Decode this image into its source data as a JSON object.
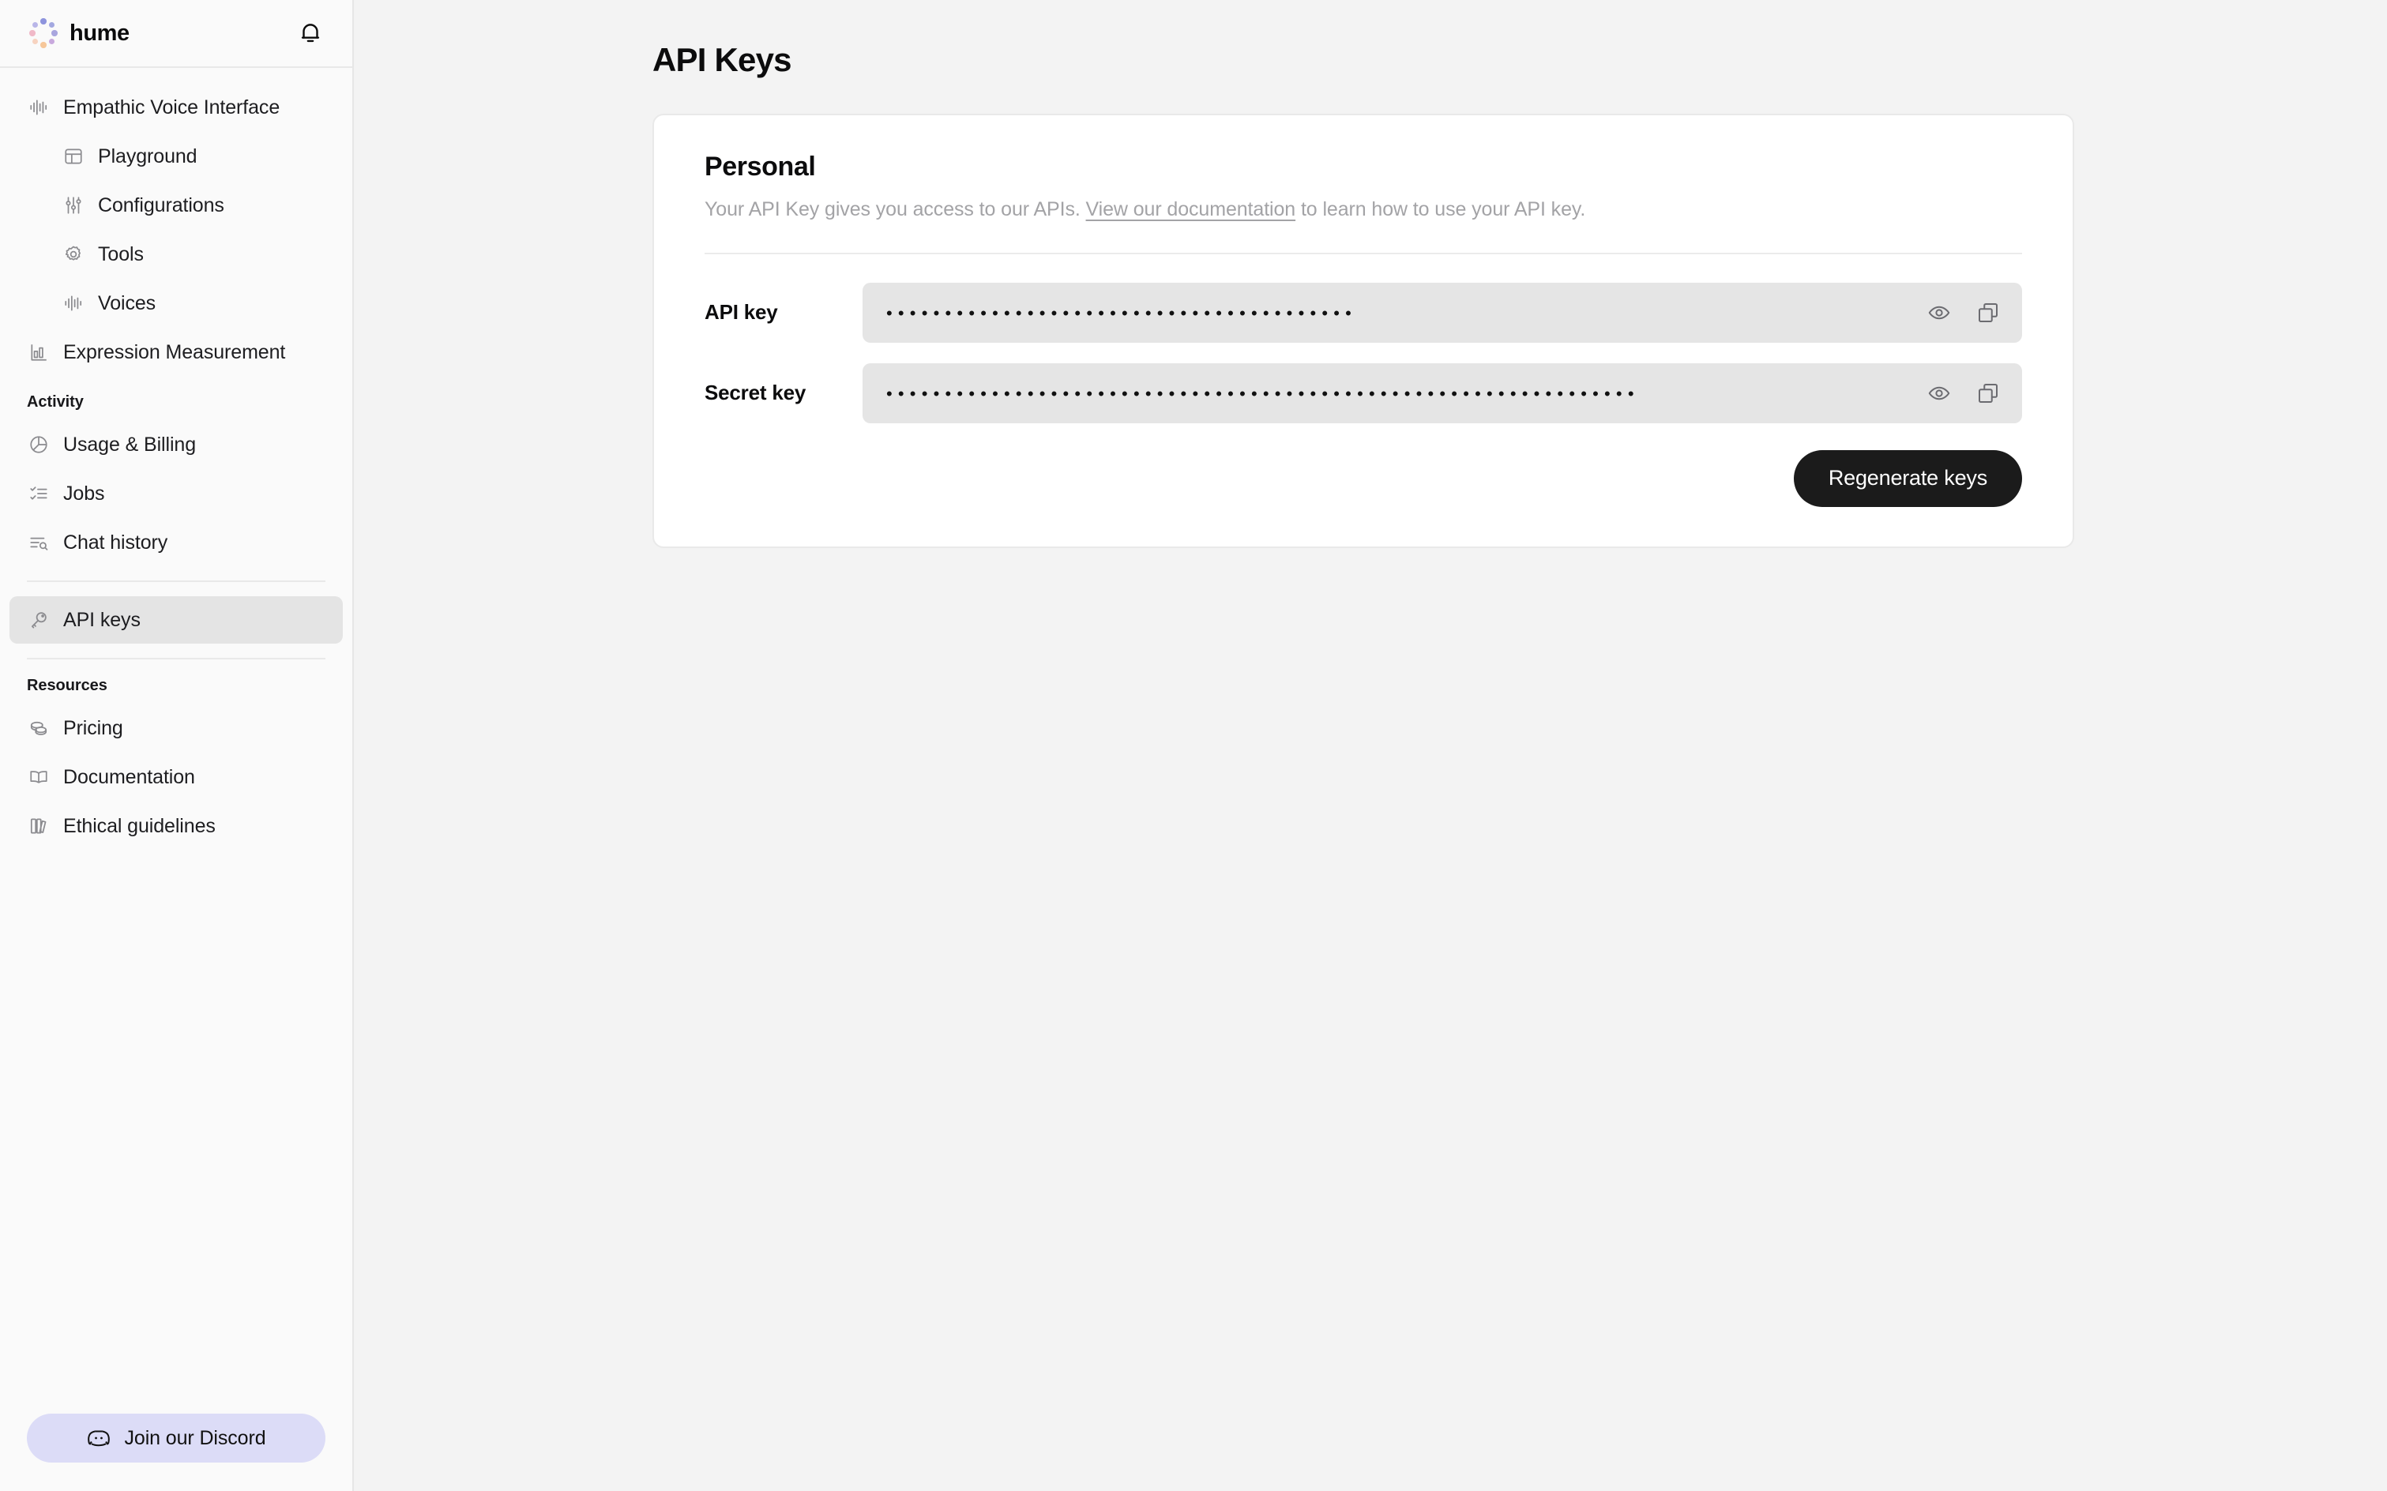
{
  "brand": {
    "name": "hume",
    "logo_icon": "hume-dots-logo",
    "logo_colors": [
      "#b9b6e8",
      "#a3a8e0",
      "#8e94dd",
      "#c3a9e0",
      "#a9a6de",
      "#f0b9c8",
      "#f7d3c0",
      "#f6c79a"
    ]
  },
  "header": {
    "notification_icon": "bell-icon"
  },
  "sidebar": {
    "primary": [
      {
        "label": "Empathic Voice Interface",
        "icon": "waveform-icon",
        "level": "top",
        "active": false
      },
      {
        "label": "Playground",
        "icon": "layout-icon",
        "level": "sub",
        "active": false
      },
      {
        "label": "Configurations",
        "icon": "sliders-icon",
        "level": "sub",
        "active": false
      },
      {
        "label": "Tools",
        "icon": "gear-icon",
        "level": "sub",
        "active": false
      },
      {
        "label": "Voices",
        "icon": "waveform-icon",
        "level": "sub",
        "active": false
      },
      {
        "label": "Expression Measurement",
        "icon": "bar-chart-icon",
        "level": "top",
        "active": false
      }
    ],
    "activity": {
      "title": "Activity",
      "items": [
        {
          "label": "Usage & Billing",
          "icon": "pie-chart-icon",
          "active": false
        },
        {
          "label": "Jobs",
          "icon": "checklist-icon",
          "active": false
        },
        {
          "label": "Chat history",
          "icon": "list-search-icon",
          "active": false
        }
      ]
    },
    "keys": {
      "items": [
        {
          "label": "API keys",
          "icon": "key-icon",
          "active": true
        }
      ]
    },
    "resources": {
      "title": "Resources",
      "items": [
        {
          "label": "Pricing",
          "icon": "coins-icon",
          "active": false
        },
        {
          "label": "Documentation",
          "icon": "book-open-icon",
          "active": false
        },
        {
          "label": "Ethical guidelines",
          "icon": "books-icon",
          "active": false
        }
      ]
    },
    "footer": {
      "discord_label": "Join our Discord",
      "discord_icon": "discord-icon",
      "discord_bg": "#dcdcf7"
    }
  },
  "main": {
    "page_title": "API Keys",
    "card": {
      "title": "Personal",
      "description_before": "Your API Key gives you access to our APIs. ",
      "description_link": "View our documentation",
      "description_after": " to learn how to use your API key.",
      "fields": [
        {
          "label": "API key",
          "masked_value": "••••••••••••••••••••••••••••••••••••••••",
          "reveal_icon": "eye-icon",
          "copy_icon": "copy-icon"
        },
        {
          "label": "Secret key",
          "masked_value": "••••••••••••••••••••••••••••••••••••••••••••••••••••••••••••••••",
          "reveal_icon": "eye-icon",
          "copy_icon": "copy-icon"
        }
      ],
      "regenerate_label": "Regenerate keys",
      "regenerate_bg": "#1b1b1b"
    }
  }
}
